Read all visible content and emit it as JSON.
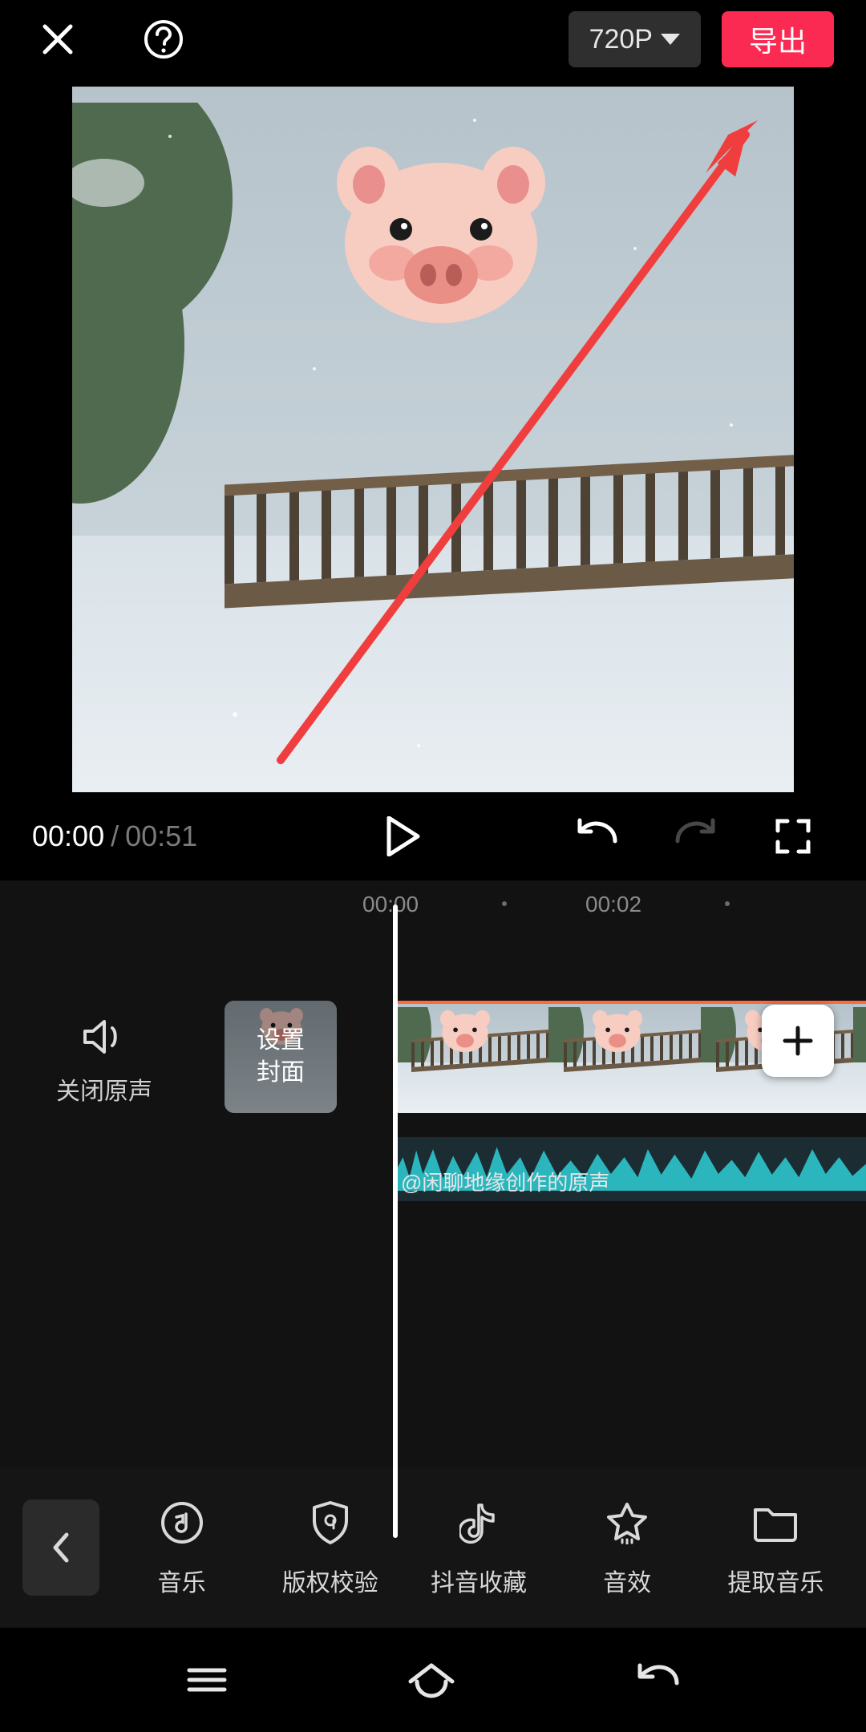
{
  "topbar": {
    "resolution_label": "720P",
    "export_label": "导出"
  },
  "playback": {
    "current_time": "00:00",
    "separator": "/",
    "duration": "00:51"
  },
  "ruler": {
    "ticks": [
      "00:00",
      "00:02"
    ]
  },
  "timeline": {
    "mute_label": "关闭原声",
    "cover_label": "设置\n封面",
    "audio_label": "@闲聊地缘创作的原声"
  },
  "toolbar": {
    "items": [
      {
        "id": "music",
        "label": "音乐"
      },
      {
        "id": "copyright",
        "label": "版权校验"
      },
      {
        "id": "douyin-fav",
        "label": "抖音收藏"
      },
      {
        "id": "sound-fx",
        "label": "音效"
      },
      {
        "id": "extract-music",
        "label": "提取音乐"
      }
    ]
  }
}
